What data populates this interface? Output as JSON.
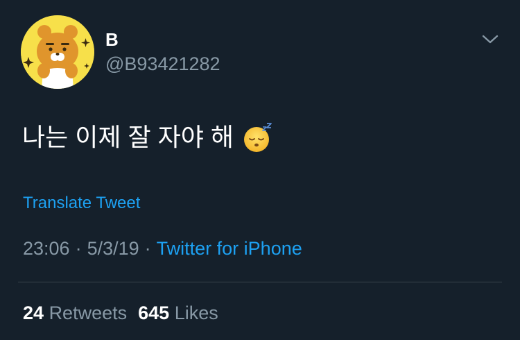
{
  "user": {
    "display_name": "B",
    "handle": "@B93421282",
    "avatar_icon": "kakao-ryan-avatar"
  },
  "tweet": {
    "text": "나는 이제 잘 자야 해",
    "emoji_icon": "sleeping-face-emoji",
    "translate_label": "Translate Tweet",
    "time": "23:06",
    "separator": "·",
    "date": "5/3/19",
    "source": "Twitter for iPhone"
  },
  "stats": {
    "retweets_count": "24",
    "retweets_label": "Retweets",
    "likes_count": "645",
    "likes_label": "Likes"
  },
  "colors": {
    "background": "#15202b",
    "secondary_text": "#8899a6",
    "link": "#1da1f2",
    "divider": "#38444d"
  }
}
